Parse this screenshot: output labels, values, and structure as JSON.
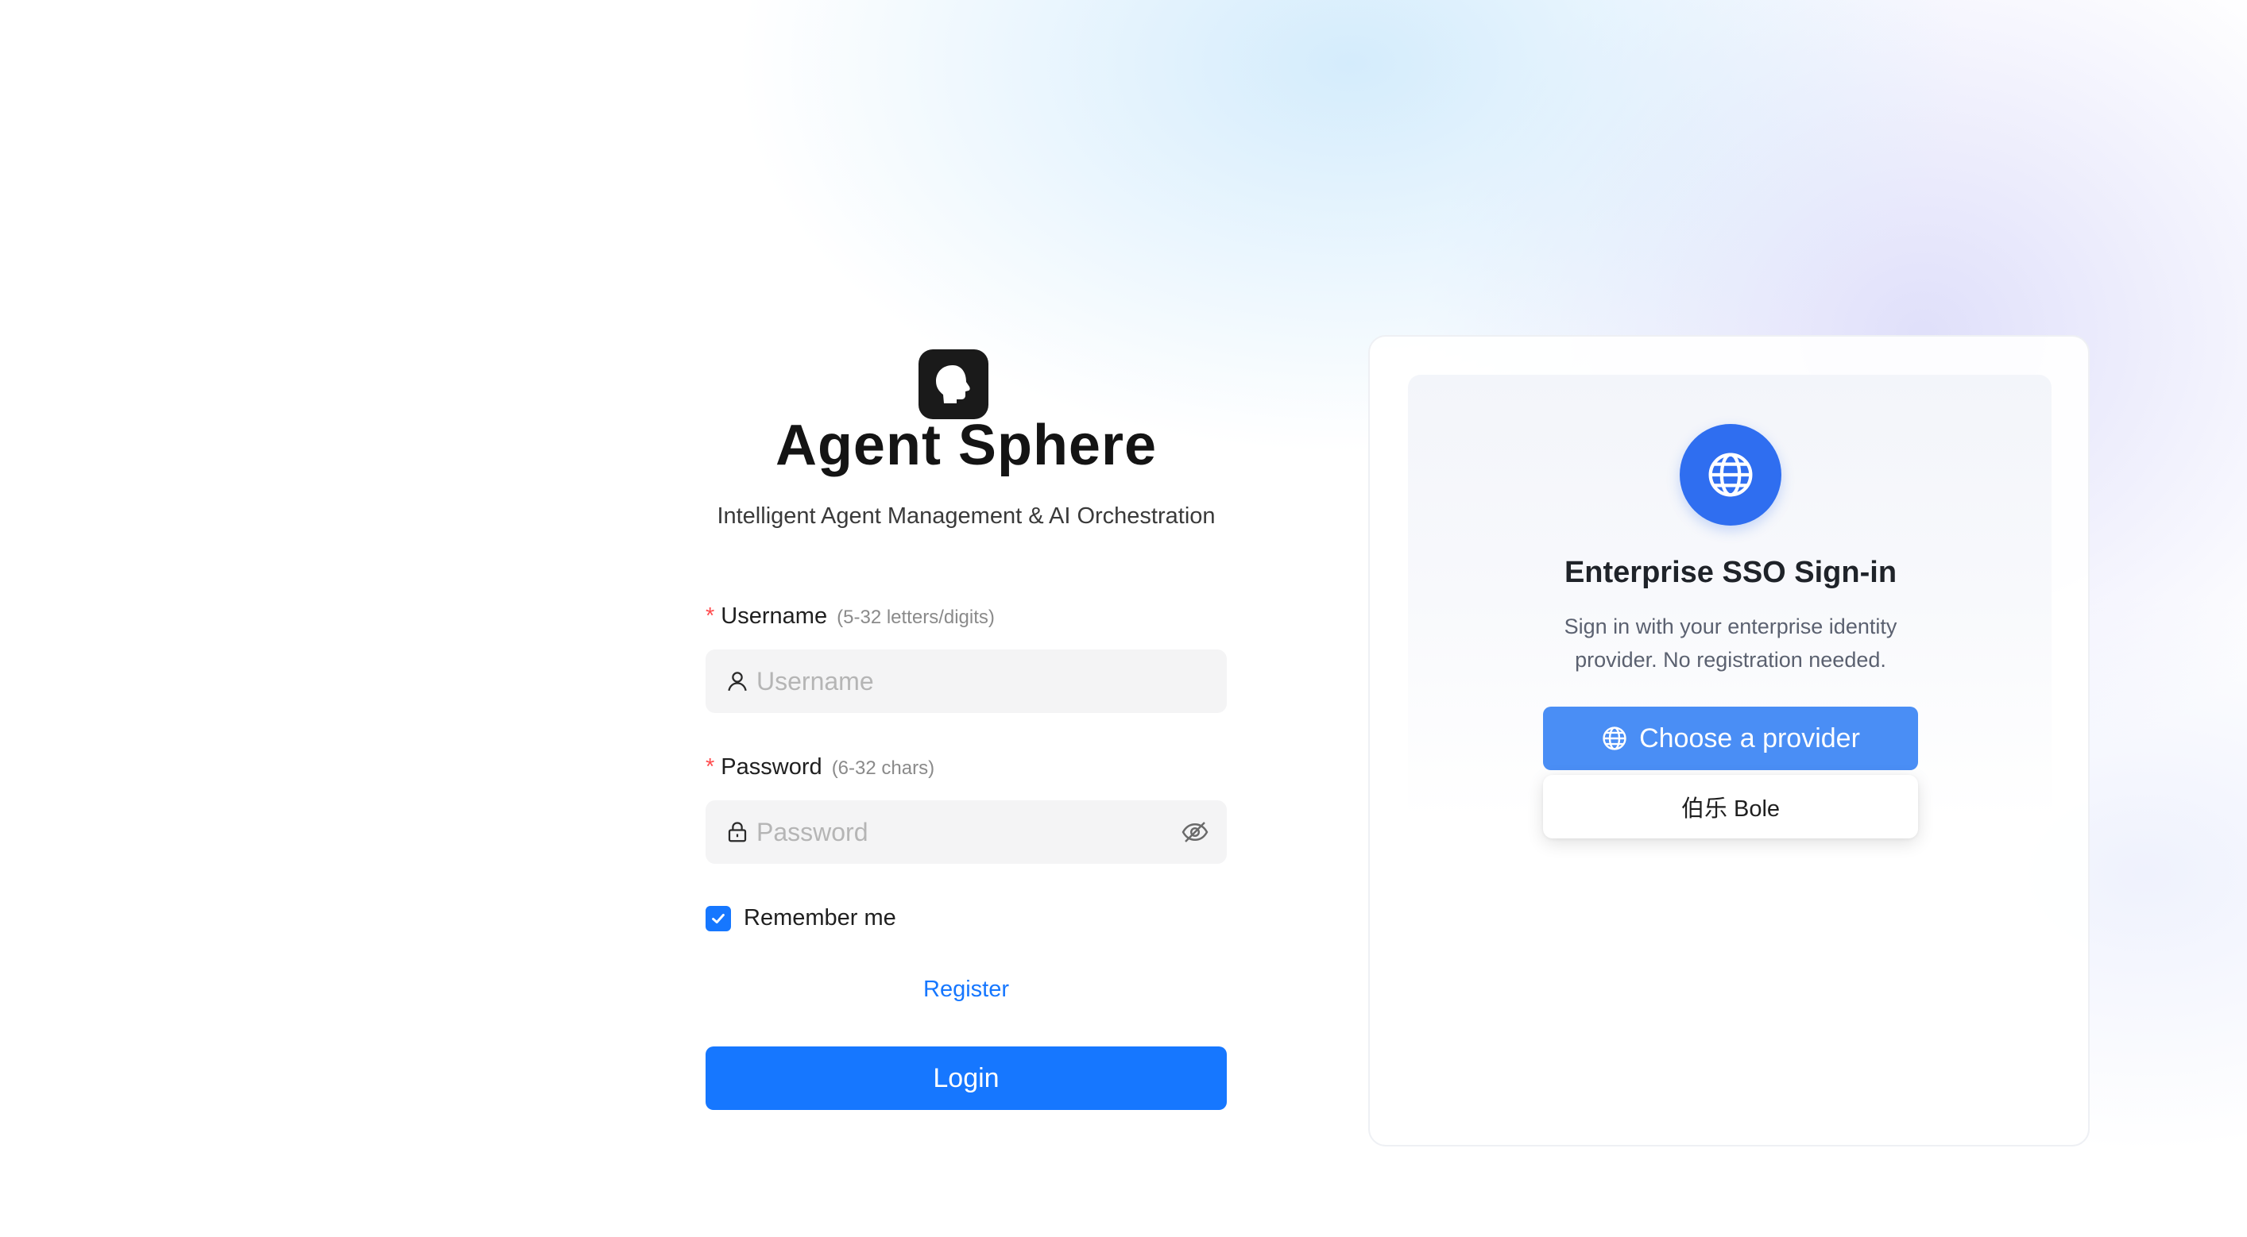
{
  "app": {
    "title": "Agent Sphere",
    "subtitle": "Intelligent Agent Management & AI Orchestration",
    "logo_icon": "head-silhouette-icon"
  },
  "login_form": {
    "username": {
      "required_mark": "*",
      "label": "Username",
      "hint": "(5-32 letters/digits)",
      "placeholder": "Username",
      "value": "",
      "icon": "user-icon"
    },
    "password": {
      "required_mark": "*",
      "label": "Password",
      "hint": "(6-32 chars)",
      "placeholder": "Password",
      "value": "",
      "icon": "lock-icon",
      "toggle_icon": "eye-slash-icon"
    },
    "remember": {
      "label": "Remember me",
      "checked": true
    },
    "register_link": "Register",
    "submit_label": "Login"
  },
  "sso": {
    "icon": "globe-icon",
    "title": "Enterprise SSO Sign-in",
    "description": "Sign in with your enterprise identity provider. No registration needed.",
    "choose_button": "Choose a provider",
    "providers": [
      {
        "label": "伯乐 Bole"
      }
    ]
  },
  "colors": {
    "primary": "#1677ff",
    "provider_button": "#4a8ef5",
    "globe_circle": "#2f6ef0",
    "required": "#ff4d4f",
    "input_bg": "#f4f4f5"
  }
}
